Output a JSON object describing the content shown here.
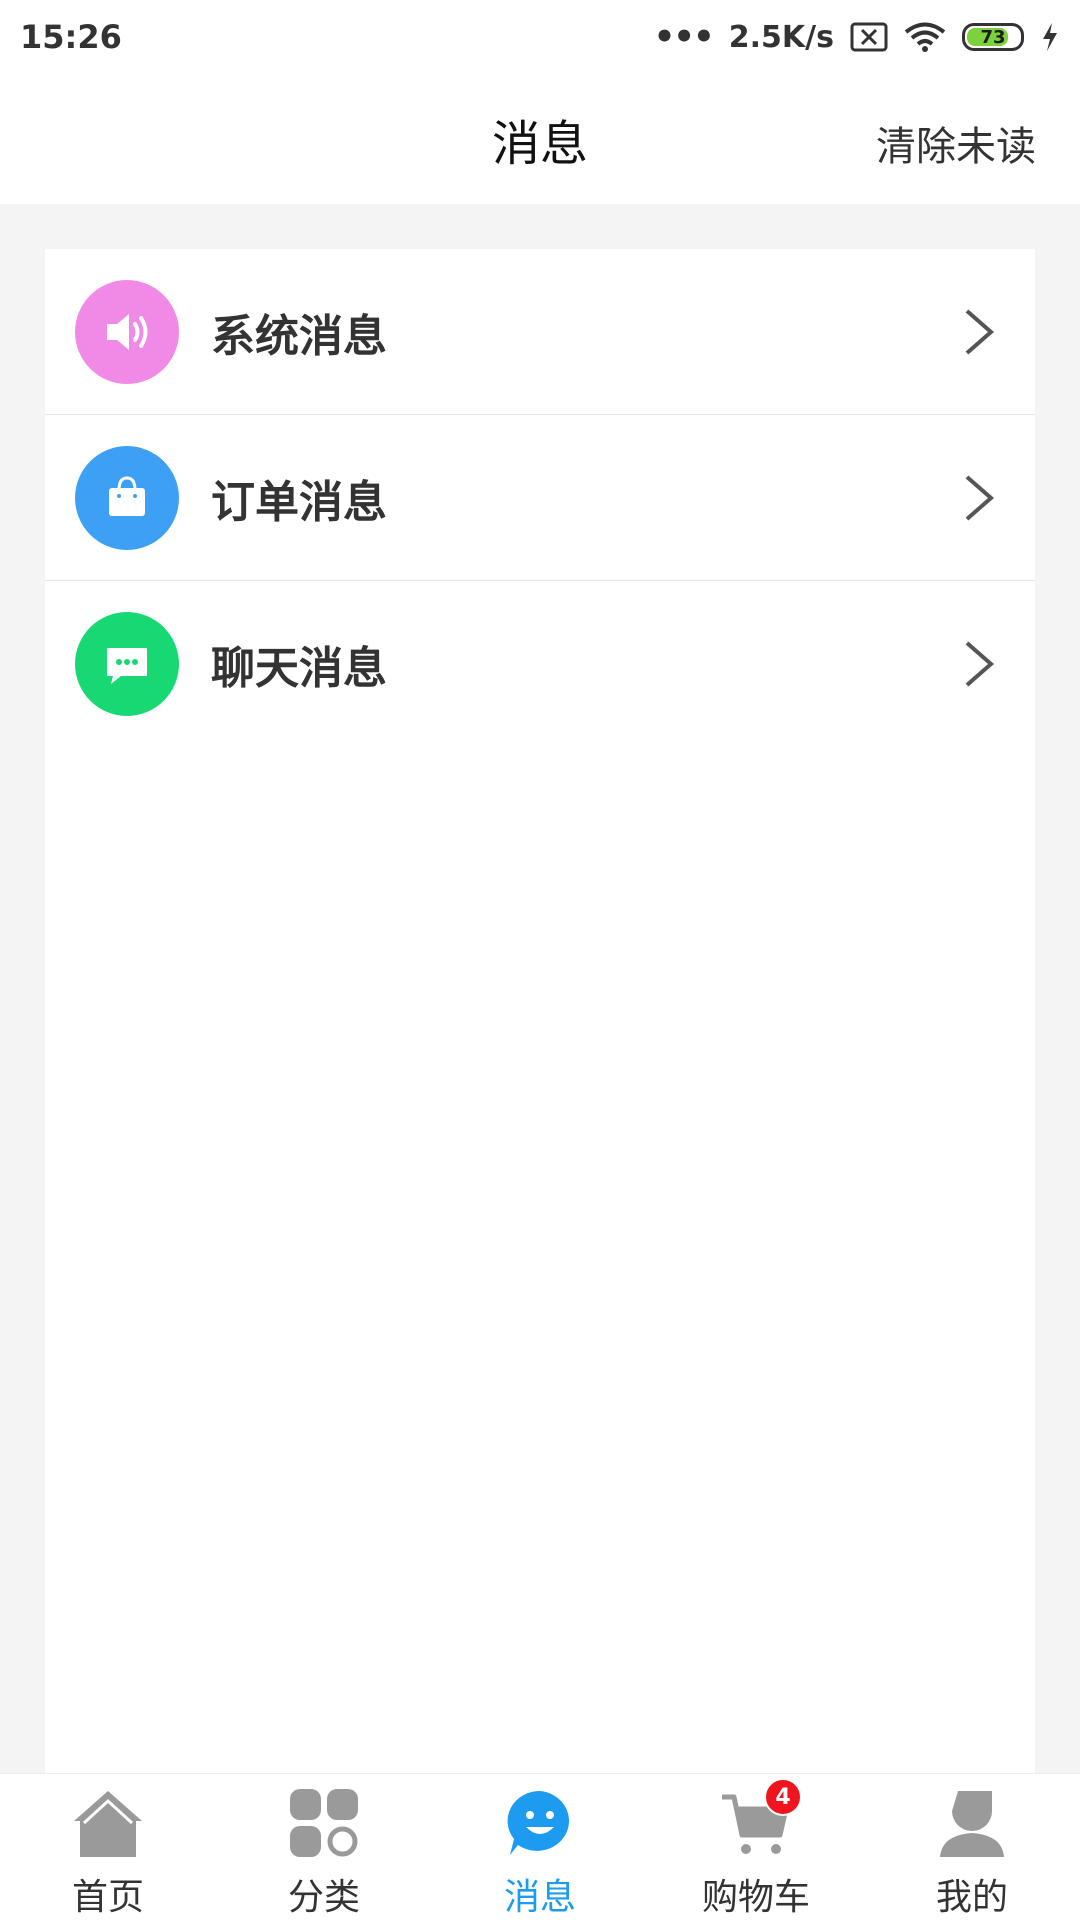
{
  "status_bar": {
    "time": "15:26",
    "dots": "•••",
    "network_speed": "2.5K/s",
    "battery_level": "73",
    "icons": [
      "sim-off-icon",
      "wifi-icon",
      "battery-icon",
      "charging-icon"
    ]
  },
  "header": {
    "title": "消息",
    "action_label": "清除未读"
  },
  "messages": [
    {
      "label": "系统消息",
      "icon": "speaker-icon",
      "color": "#f08ae6"
    },
    {
      "label": "订单消息",
      "icon": "shopping-bag-icon",
      "color": "#3ea0f5"
    },
    {
      "label": "聊天消息",
      "icon": "chat-bubble-icon",
      "color": "#17d873"
    }
  ],
  "tabbar": {
    "tabs": [
      {
        "label": "首页",
        "icon": "home-icon",
        "active": false
      },
      {
        "label": "分类",
        "icon": "category-icon",
        "active": false
      },
      {
        "label": "消息",
        "icon": "message-smile-icon",
        "active": true
      },
      {
        "label": "购物车",
        "icon": "cart-icon",
        "active": false,
        "badge": "4"
      },
      {
        "label": "我的",
        "icon": "user-icon",
        "active": false
      }
    ]
  },
  "colors": {
    "accent": "#1d9bf0",
    "badge": "#f0141e",
    "inactive_icon": "#9a9a9a",
    "battery": "#7cd23c"
  }
}
